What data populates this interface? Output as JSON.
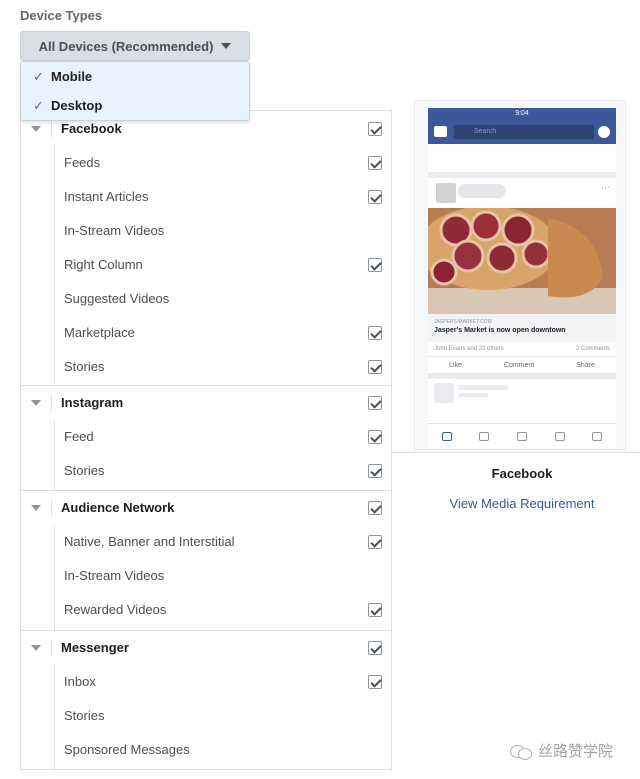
{
  "header": {
    "title": "Device Types"
  },
  "device_dropdown": {
    "selected": "All Devices (Recommended)",
    "options": [
      {
        "label": "Mobile",
        "checked": true
      },
      {
        "label": "Desktop",
        "checked": true
      }
    ]
  },
  "placements": [
    {
      "name": "Facebook",
      "checked": true,
      "items": [
        {
          "label": "Feeds",
          "checked": true
        },
        {
          "label": "Instant Articles",
          "checked": true
        },
        {
          "label": "In-Stream Videos",
          "checked": false
        },
        {
          "label": "Right Column",
          "checked": true
        },
        {
          "label": "Suggested Videos",
          "checked": false
        },
        {
          "label": "Marketplace",
          "checked": true
        },
        {
          "label": "Stories",
          "checked": true
        }
      ]
    },
    {
      "name": "Instagram",
      "checked": true,
      "items": [
        {
          "label": "Feed",
          "checked": true
        },
        {
          "label": "Stories",
          "checked": true
        }
      ]
    },
    {
      "name": "Audience Network",
      "checked": true,
      "items": [
        {
          "label": "Native, Banner and Interstitial",
          "checked": true
        },
        {
          "label": "In-Stream Videos",
          "checked": false
        },
        {
          "label": "Rewarded Videos",
          "checked": true
        }
      ]
    },
    {
      "name": "Messenger",
      "checked": true,
      "items": [
        {
          "label": "Inbox",
          "checked": true
        },
        {
          "label": "Stories",
          "checked": false
        },
        {
          "label": "Sponsored Messages",
          "checked": false
        }
      ]
    }
  ],
  "preview": {
    "status_time": "9:04",
    "search_placeholder": "Search",
    "post_domain": "JASPERS-MARKET.COM",
    "post_headline": "Jasper's Market is now open downtown",
    "reactions_text": "John Evans and 23 others",
    "comments_text": "2 Comments",
    "like_label": "Like",
    "comment_label": "Comment",
    "share_label": "Share",
    "placement_name": "Facebook",
    "requirements_link": "View Media Requirement"
  },
  "watermark": {
    "text": "丝路赞学院"
  },
  "colors": {
    "fb_blue": "#3b5998",
    "link_blue": "#385898",
    "menu_bg": "#e7f3ff"
  }
}
